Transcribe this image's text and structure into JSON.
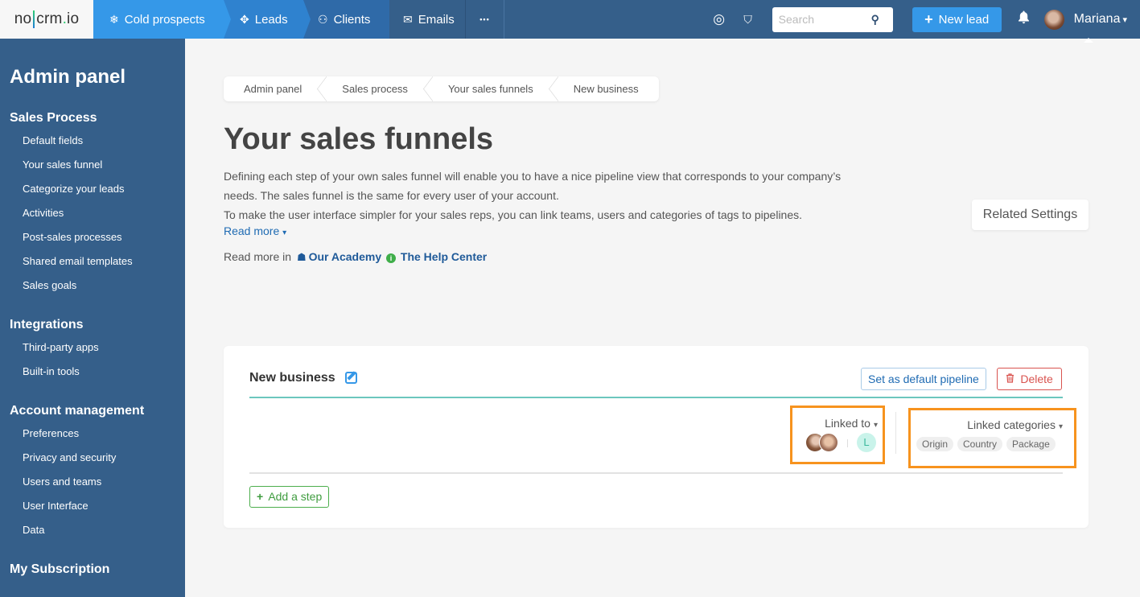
{
  "app": {
    "logo": {
      "left": "no",
      "right": "crm",
      "dot": ".",
      "tld": "io"
    }
  },
  "topnav": {
    "tabs": [
      {
        "label": "Cold prospects",
        "icon": "snowflake-icon",
        "glyph": "❄"
      },
      {
        "label": "Leads",
        "icon": "crosshair-icon",
        "glyph": "✥"
      },
      {
        "label": "Clients",
        "icon": "handshake-icon",
        "glyph": "⚇"
      },
      {
        "label": "Emails",
        "icon": "envelope-icon",
        "glyph": "✉"
      }
    ],
    "more_label": "•••",
    "target_icon": "◎",
    "bookmark_icon": "⛉",
    "search_placeholder": "Search",
    "search_value": "",
    "search_icon": "⚲",
    "new_lead_label": "New lead",
    "new_lead_plus": "+",
    "bell_icon": "🔔",
    "user_name": "Mariana",
    "user_caret": "▾"
  },
  "sidebar": {
    "title": "Admin panel",
    "sections": [
      {
        "heading": "Sales Process",
        "items": [
          "Default fields",
          "Your sales funnel",
          "Categorize your leads",
          "Activities",
          "Post-sales processes",
          "Shared email templates",
          "Sales goals"
        ]
      },
      {
        "heading": "Integrations",
        "items": [
          "Third-party apps",
          "Built-in tools"
        ]
      },
      {
        "heading": "Account management",
        "items": [
          "Preferences",
          "Privacy and security",
          "Users and teams",
          "User Interface",
          "Data"
        ]
      },
      {
        "heading": "My Subscription",
        "items": []
      }
    ]
  },
  "main": {
    "breadcrumb": [
      "Admin panel",
      "Sales process",
      "Your sales funnels",
      "New business"
    ],
    "title": "Your sales funnels",
    "description_line1": "Defining each step of your own sales funnel will enable you to have a nice pipeline view that corresponds to your company’s needs. The sales funnel is the same for every user of your account.",
    "description_line2": "To make the user interface simpler for your sales reps, you can link teams, users and categories of tags to pipelines.",
    "read_more_label": "Read more",
    "read_more_caret": "▾",
    "read_more_in_label": "Read more in",
    "academy_link": "Our Academy",
    "academy_icon": "☗",
    "help_center_link": "The Help Center",
    "help_icon": "i",
    "related_settings_label": "Related Settings"
  },
  "pipeline": {
    "name": "New business",
    "set_default_label": "Set as default pipeline",
    "delete_label": "Delete",
    "delete_icon": "🗑",
    "linked_to_label": "Linked to",
    "linked_to_caret": "▾",
    "linked_team_initial": "L",
    "linked_categories_label": "Linked categories",
    "linked_categories_caret": "▾",
    "categories": [
      "Origin",
      "Country",
      "Package"
    ],
    "add_step_label": "Add a step",
    "add_step_plus": "+",
    "colors": {
      "accent_line": "#6cc7be",
      "highlight_box": "#f7931e",
      "delete": "#d9534f",
      "add_step": "#4cae4c"
    }
  }
}
